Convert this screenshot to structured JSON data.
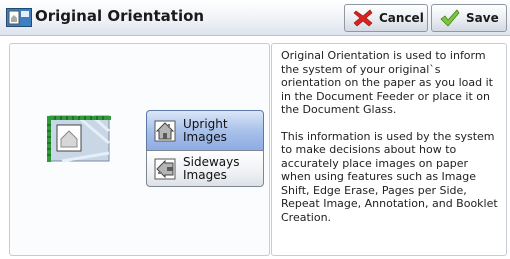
{
  "header": {
    "title": "Original Orientation",
    "cancel_label": "Cancel",
    "save_label": "Save",
    "icons": {
      "title": "original-orientation-icon",
      "cancel": "red-x-icon",
      "save": "green-check-icon"
    }
  },
  "options": [
    {
      "label": "Upright Images",
      "selected": true,
      "icon": "upright-house-icon"
    },
    {
      "label_line1": "Sideways",
      "label_line2": "Images",
      "selected": false,
      "icon": "sideways-house-icon"
    }
  ],
  "description": {
    "para1": "Original Orientation is used to inform the system of your original`s orientation on the paper as you load it in the Document Feeder or place it on the Document Glass.",
    "para2": "This information is used by the system to make decisions about how to accurately place images on paper when using features such as Image Shift, Edge Erase, Pages per Side, Repeat Image, Annotation, and Booklet Creation."
  },
  "colors": {
    "selected_bg": "#a9c1ea",
    "cancel_icon": "#d8241c",
    "save_icon": "#5fb02a"
  }
}
